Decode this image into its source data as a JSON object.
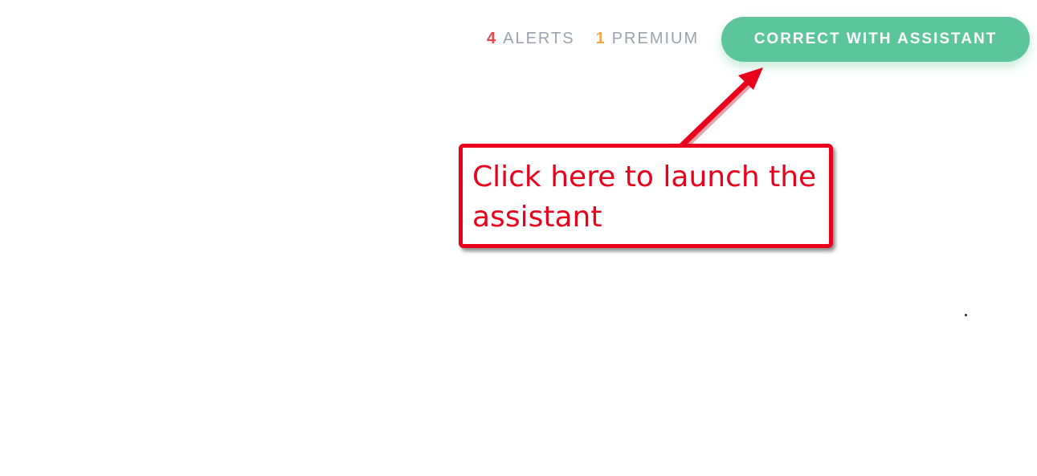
{
  "header": {
    "alerts": {
      "count": "4",
      "label": "ALERTS",
      "color": "#e8454c"
    },
    "premium": {
      "count": "1",
      "label": "PREMIUM",
      "color": "#f2a84b"
    },
    "assistant_button": {
      "label": "CORRECT WITH ASSISTANT",
      "color": "#5cc59b"
    }
  },
  "annotation": {
    "text": "Click here to launch the assistant",
    "color": "#e8001c",
    "pointer_icon": "arrow-up-right-icon"
  }
}
